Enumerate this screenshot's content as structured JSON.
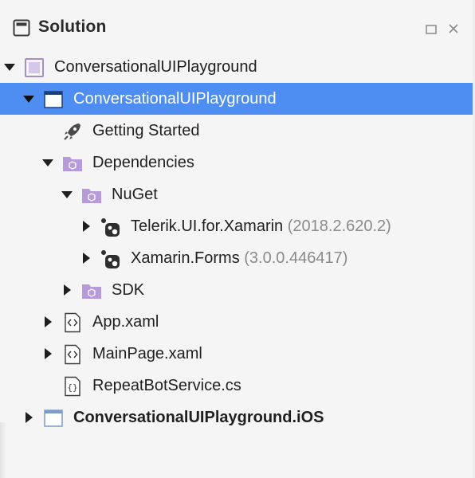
{
  "header": {
    "title": "Solution"
  },
  "colors": {
    "selection": "#4e8df1",
    "folder": "#b79ad9",
    "project": "#8fa0bf",
    "version_text": "#8a8a8a"
  },
  "tree": [
    {
      "label": "ConversationalUIPlayground",
      "icon": "solution-icon",
      "expanded": true
    },
    {
      "label": "ConversationalUIPlayground",
      "icon": "project-icon",
      "expanded": true,
      "selected": true
    },
    {
      "label": "Getting Started",
      "icon": "rocket-icon"
    },
    {
      "label": "Dependencies",
      "icon": "folder-icon",
      "expanded": true
    },
    {
      "label": "NuGet",
      "icon": "folder-icon",
      "expanded": true
    },
    {
      "label": "Telerik.UI.for.Xamarin",
      "version": "(2018.2.620.2)",
      "icon": "nuget-package-icon",
      "expanded": false
    },
    {
      "label": "Xamarin.Forms",
      "version": "(3.0.0.446417)",
      "icon": "nuget-package-icon",
      "expanded": false
    },
    {
      "label": "SDK",
      "icon": "folder-icon",
      "expanded": false
    },
    {
      "label": "App.xaml",
      "icon": "xaml-file-icon",
      "expanded": false
    },
    {
      "label": "MainPage.xaml",
      "icon": "xaml-file-icon",
      "expanded": false
    },
    {
      "label": "RepeatBotService.cs",
      "icon": "cs-file-icon"
    },
    {
      "label": "ConversationalUIPlayground.iOS",
      "icon": "project-icon",
      "expanded": false
    }
  ]
}
